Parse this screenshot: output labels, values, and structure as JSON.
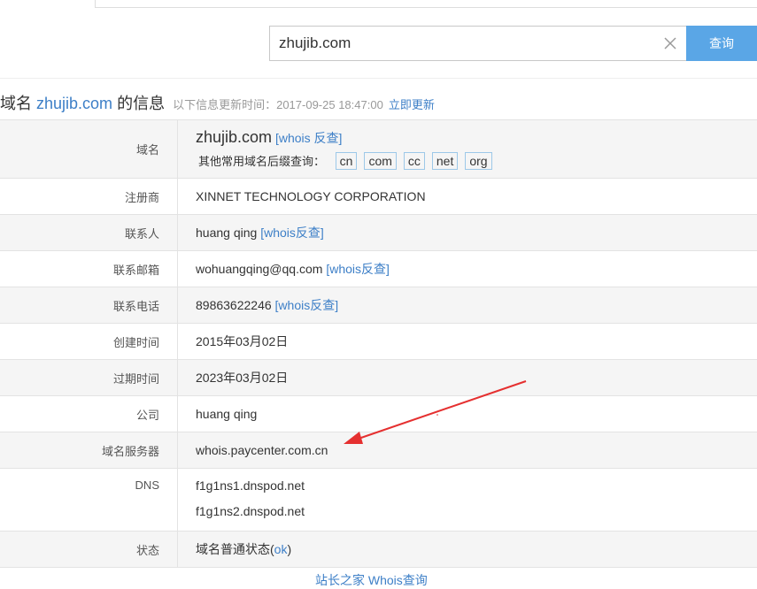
{
  "search": {
    "value": "zhujib.com",
    "button_label": "查询"
  },
  "title": {
    "prefix": "域名",
    "domain": "zhujib.com",
    "suffix": "的信息",
    "update_text": "以下信息更新时间：2017-09-25 18:47:00",
    "refresh_label": "立即更新"
  },
  "rows": {
    "domain": {
      "label": "域名",
      "value": "zhujib.com",
      "whois_link": "[whois 反查]",
      "suffix_prompt": "其他常用域名后缀查询：",
      "suffixes": [
        "cn",
        "com",
        "cc",
        "net",
        "org"
      ]
    },
    "registrar": {
      "label": "注册商",
      "value": "XINNET TECHNOLOGY CORPORATION"
    },
    "contact": {
      "label": "联系人",
      "value": "huang qing",
      "whois_link": "[whois反查]"
    },
    "email": {
      "label": "联系邮箱",
      "value": "wohuangqing@qq.com",
      "whois_link": "[whois反查]"
    },
    "phone": {
      "label": "联系电话",
      "value": "89863622246",
      "whois_link": "[whois反查]"
    },
    "created": {
      "label": "创建时间",
      "value": "2015年03月02日"
    },
    "expires": {
      "label": "过期时间",
      "value": "2023年03月02日"
    },
    "company": {
      "label": "公司",
      "value": "huang qing"
    },
    "whois_server": {
      "label": "域名服务器",
      "value": "whois.paycenter.com.cn"
    },
    "dns": {
      "label": "DNS",
      "values": [
        "f1g1ns1.dnspod.net",
        "f1g1ns2.dnspod.net"
      ]
    },
    "status": {
      "label": "状态",
      "value_prefix": "域名普通状态(",
      "value_code": "ok",
      "value_suffix": ")"
    }
  },
  "footer": {
    "link": "站长之家 Whois查询"
  },
  "colors": {
    "accent": "#3d7fc7",
    "button": "#5aa6e6",
    "annotation_arrow": "#e53030"
  }
}
